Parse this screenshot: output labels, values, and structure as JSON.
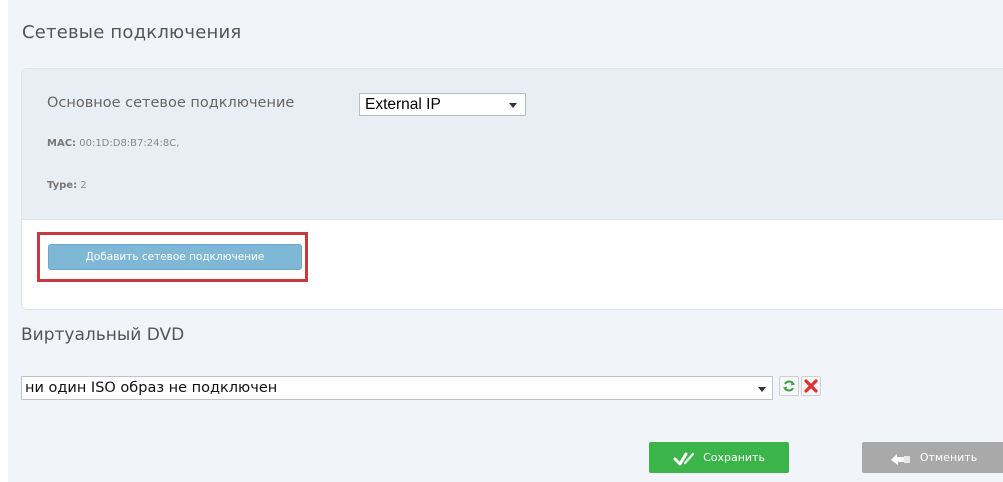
{
  "network": {
    "title": "Сетевые подключения",
    "primary_label": "Основное сетевое подключение",
    "primary_selected": "External IP",
    "mac_key": "MAC:",
    "mac_value": "00:1D:D8:B7:24:8C,",
    "type_key": "Type:",
    "type_value": "2",
    "add_label": "Добавить сетевое подключение"
  },
  "dvd": {
    "title": "Виртуальный DVD",
    "iso_selected": "ни один ISO образ не подключен",
    "refresh_icon": "refresh-icon",
    "remove_icon": "remove-icon"
  },
  "actions": {
    "save_label": "Сохранить",
    "cancel_label": "Отменить",
    "save_icon": "check-icon",
    "cancel_icon": "undo-icon"
  },
  "colors": {
    "highlight": "#c83a3f",
    "add_button": "#7fb8d6",
    "save": "#3bb54a",
    "cancel": "#a9a9a9",
    "remove": "#e03030"
  }
}
